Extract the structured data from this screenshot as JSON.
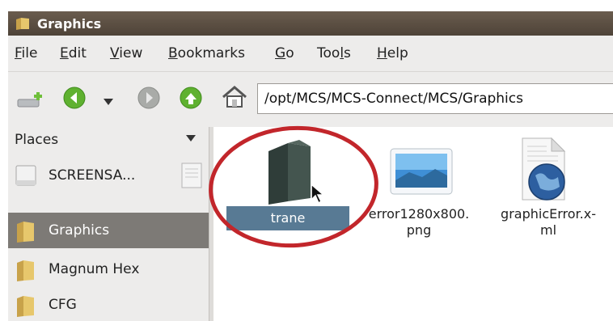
{
  "window": {
    "title": "Graphics",
    "title_icon": "folder-icon"
  },
  "menu": {
    "items": [
      {
        "pre": "",
        "u": "F",
        "post": "ile"
      },
      {
        "pre": "",
        "u": "E",
        "post": "dit"
      },
      {
        "pre": "",
        "u": "V",
        "post": "iew"
      },
      {
        "pre": "",
        "u": "B",
        "post": "ookmarks"
      },
      {
        "pre": "",
        "u": "G",
        "post": "o"
      },
      {
        "pre": "Too",
        "u": "l",
        "post": "s"
      },
      {
        "pre": "",
        "u": "H",
        "post": "elp"
      }
    ]
  },
  "toolbar": {
    "location": "/opt/MCS/MCS-Connect/MCS/Graphics",
    "icons": [
      "new-window-icon",
      "back-icon",
      "dropdown-icon",
      "forward-icon",
      "up-icon",
      "home-icon"
    ]
  },
  "sidebar": {
    "header": "Places",
    "items": [
      {
        "label": "SCREENSA...",
        "icon": "drive-icon",
        "selected": false
      },
      {
        "label": "Graphics",
        "icon": "folder-icon",
        "selected": true
      },
      {
        "label": "Magnum Hex",
        "icon": "folder-icon",
        "selected": false
      },
      {
        "label": "CFG",
        "icon": "folder-icon",
        "selected": false
      }
    ]
  },
  "files": [
    {
      "name": "trane",
      "icon": "folder-icon",
      "selected": true
    },
    {
      "name_line1": "error1280x800.",
      "name_line2": "png",
      "icon": "image-icon",
      "selected": false
    },
    {
      "name_line1": "graphicError.x-",
      "name_line2": "ml",
      "icon": "xml-icon",
      "selected": false
    }
  ],
  "colors": {
    "titlebar": "#5a4e42",
    "selection": "#587a94",
    "sidebar_selected": "#7d7a76",
    "highlight_ring": "#c2262b"
  }
}
